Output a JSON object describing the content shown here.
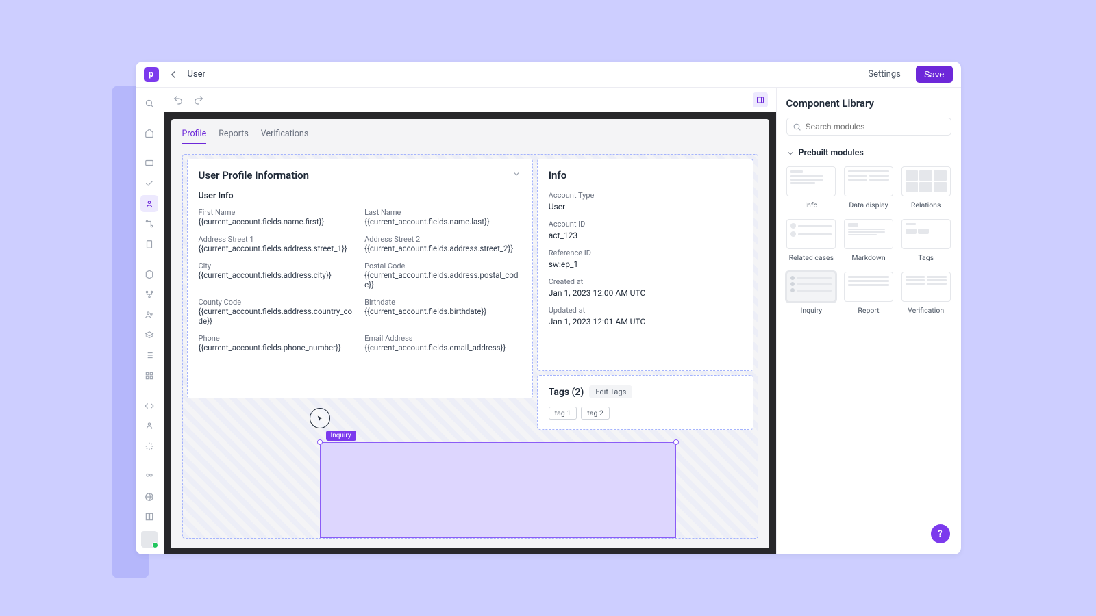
{
  "header": {
    "logo_letter": "p",
    "page_title": "User",
    "settings_label": "Settings",
    "save_label": "Save"
  },
  "tabs": {
    "profile": "Profile",
    "reports": "Reports",
    "verifications": "Verifications"
  },
  "profile_card": {
    "title": "User Profile Information",
    "section": "User Info",
    "fields": {
      "first_name_label": "First Name",
      "first_name_value": "{{current_account.fields.name.first}}",
      "last_name_label": "Last Name",
      "last_name_value": "{{current_account.fields.name.last}}",
      "addr1_label": "Address Street 1",
      "addr1_value": "{{current_account.fields.address.street_1}}",
      "addr2_label": "Address Street 2",
      "addr2_value": "{{current_account.fields.address.street_2}}",
      "city_label": "City",
      "city_value": "{{current_account.fields.address.city}}",
      "postal_label": "Postal Code",
      "postal_value": "{{current_account.fields.address.postal_code}}",
      "country_label": "County Code",
      "country_value": "{{current_account.fields.address.country_code}}",
      "birth_label": "Birthdate",
      "birth_value": "{{current_account.fields.birthdate}}",
      "phone_label": "Phone",
      "phone_value": "{{current_account.fields.phone_number}}",
      "email_label": "Email Address",
      "email_value": "{{current_account.fields.email_address}}"
    }
  },
  "info_card": {
    "title": "Info",
    "items": {
      "acct_type_label": "Account Type",
      "acct_type_value": "User",
      "acct_id_label": "Account ID",
      "acct_id_value": "act_123",
      "ref_id_label": "Reference ID",
      "ref_id_value": "sw:ep_1",
      "created_label": "Created at",
      "created_value": "Jan 1, 2023 12:00 AM UTC",
      "updated_label": "Updated at",
      "updated_value": "Jan 1, 2023 12:01 AM UTC"
    }
  },
  "tags_card": {
    "title": "Tags (2)",
    "edit_label": "Edit Tags",
    "tag1": "tag 1",
    "tag2": "tag 2"
  },
  "drop": {
    "label": "Inquiry"
  },
  "library": {
    "title": "Component Library",
    "search_placeholder": "Search modules",
    "section": "Prebuilt modules",
    "modules": {
      "info": "Info",
      "data_display": "Data display",
      "relations": "Relations",
      "related_cases": "Related cases",
      "markdown": "Markdown",
      "tags": "Tags",
      "inquiry": "Inquiry",
      "report": "Report",
      "verification": "Verification"
    }
  },
  "help": "?"
}
